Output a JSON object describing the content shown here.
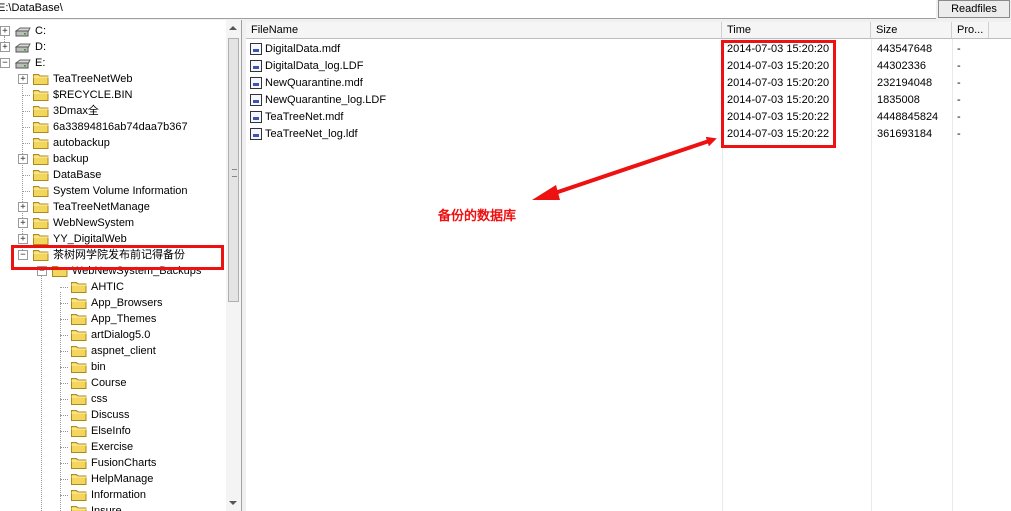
{
  "path": "E:\\DataBase\\",
  "readfiles_label": "Readfiles",
  "tree": {
    "drives": [
      "C:",
      "D:",
      "E:"
    ],
    "e_children": [
      "TeaTreeNetWeb",
      "$RECYCLE.BIN",
      "3Dmax全",
      "6a33894816ab74daa7b367",
      "autobackup",
      "backup",
      "DataBase",
      "System Volume Information",
      "TeaTreeNetManage",
      "WebNewSystem",
      "YY_DigitalWeb",
      "茶树网学院发布前记得备份"
    ],
    "backup_child": "WebNewSystem_Backups",
    "backup_sub": [
      "AHTIC",
      "App_Browsers",
      "App_Themes",
      "artDialog5.0",
      "aspnet_client",
      "bin",
      "Course",
      "css",
      "Discuss",
      "ElseInfo",
      "Exercise",
      "FusionCharts",
      "HelpManage",
      "Information",
      "Insure"
    ]
  },
  "columns": [
    "FileName",
    "Time",
    "Size",
    "Pro..."
  ],
  "files": [
    {
      "name": "DigitalData.mdf",
      "time": "2014-07-03 15:20:20",
      "size": "443547648",
      "pro": "-"
    },
    {
      "name": "DigitalData_log.LDF",
      "time": "2014-07-03 15:20:20",
      "size": "44302336",
      "pro": "-"
    },
    {
      "name": "NewQuarantine.mdf",
      "time": "2014-07-03 15:20:20",
      "size": "232194048",
      "pro": "-"
    },
    {
      "name": "NewQuarantine_log.LDF",
      "time": "2014-07-03 15:20:20",
      "size": "1835008",
      "pro": "-"
    },
    {
      "name": "TeaTreeNet.mdf",
      "time": "2014-07-03 15:20:22",
      "size": "4448845824",
      "pro": "-"
    },
    {
      "name": "TeaTreeNet_log.ldf",
      "time": "2014-07-03 15:20:22",
      "size": "361693184",
      "pro": "-"
    }
  ],
  "annotation": "备份的数据库",
  "colors": {
    "annotation_red": "#ee1111",
    "folder_yellow": "#f5d65c"
  }
}
